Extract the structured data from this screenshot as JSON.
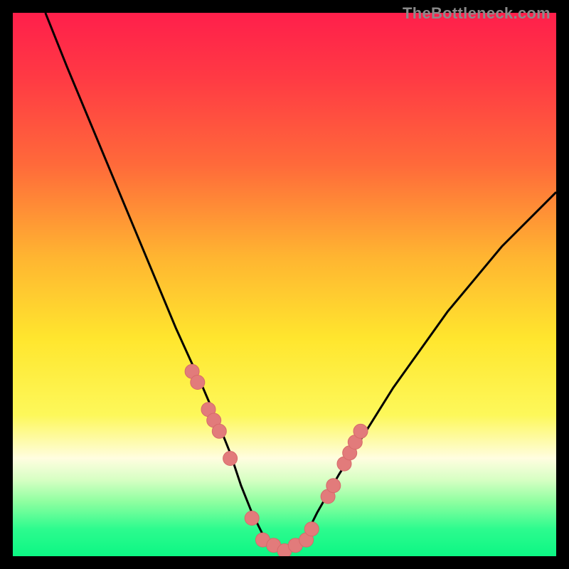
{
  "watermark": {
    "text": "TheBottleneck.com"
  },
  "colors": {
    "gradient_stops": [
      {
        "offset": 0.0,
        "color": "#ff1f4b"
      },
      {
        "offset": 0.12,
        "color": "#ff3a44"
      },
      {
        "offset": 0.28,
        "color": "#ff6a3a"
      },
      {
        "offset": 0.45,
        "color": "#ffb531"
      },
      {
        "offset": 0.6,
        "color": "#ffe62e"
      },
      {
        "offset": 0.74,
        "color": "#fdf85a"
      },
      {
        "offset": 0.82,
        "color": "#fffde0"
      },
      {
        "offset": 0.86,
        "color": "#d6ffc3"
      },
      {
        "offset": 0.9,
        "color": "#8effa0"
      },
      {
        "offset": 0.95,
        "color": "#2dfb8e"
      },
      {
        "offset": 1.0,
        "color": "#0cf784"
      }
    ],
    "curve": "#000000",
    "marker_fill": "#e27b7b",
    "marker_stroke": "#d66a6a"
  },
  "chart_data": {
    "type": "line",
    "title": "",
    "xlabel": "",
    "ylabel": "",
    "xlim": [
      0,
      100
    ],
    "ylim": [
      0,
      100
    ],
    "series": [
      {
        "name": "bottleneck-curve",
        "x": [
          6,
          10,
          15,
          20,
          25,
          30,
          35,
          38,
          40,
          42,
          44,
          46,
          48,
          50,
          52,
          54,
          56,
          60,
          65,
          70,
          75,
          80,
          85,
          90,
          95,
          100
        ],
        "values": [
          100,
          90,
          78,
          66,
          54,
          42,
          31,
          24,
          19,
          13,
          8,
          4,
          2,
          1,
          2,
          4,
          8,
          15,
          23,
          31,
          38,
          45,
          51,
          57,
          62,
          67
        ]
      }
    ],
    "markers": {
      "name": "highlighted-points",
      "x": [
        33,
        34,
        36,
        37,
        38,
        40,
        44,
        46,
        48,
        50,
        52,
        54,
        55,
        58,
        59,
        61,
        62,
        63,
        64
      ],
      "values": [
        34,
        32,
        27,
        25,
        23,
        18,
        7,
        3,
        2,
        1,
        2,
        3,
        5,
        11,
        13,
        17,
        19,
        21,
        23
      ]
    }
  }
}
